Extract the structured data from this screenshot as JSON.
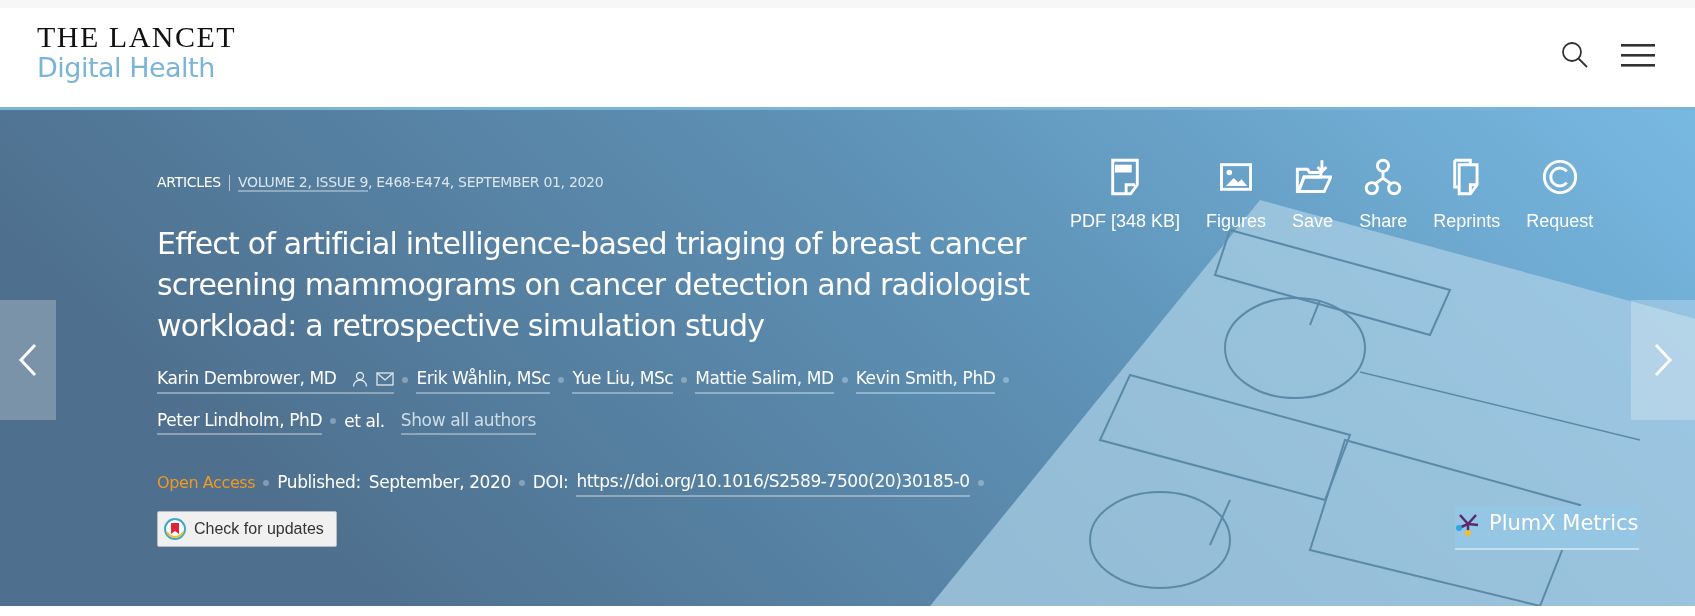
{
  "header": {
    "logo_top": "THE LANCET",
    "logo_bottom": "Digital Health"
  },
  "banner": {
    "article_type": "ARTICLES",
    "issue_link": "VOLUME 2, ISSUE 9",
    "issue_rest": ", E468-E474, SEPTEMBER 01, 2020",
    "actions": [
      {
        "kind": "pdf",
        "label": "PDF [348 KB]"
      },
      {
        "kind": "figures",
        "label": "Figures"
      },
      {
        "kind": "save",
        "label": "Save"
      },
      {
        "kind": "share",
        "label": "Share"
      },
      {
        "kind": "reprints",
        "label": "Reprints"
      },
      {
        "kind": "request",
        "label": "Request"
      }
    ],
    "title": "Effect of artificial intelligence-based triaging of breast cancer screening mammograms on cancer detection and radiologist workload: a retrospective simulation study",
    "authors": [
      {
        "name": "Karin Dembrower, MD",
        "kind": "corresponding"
      },
      {
        "name": "Erik Wåhlin, MSc",
        "kind": "author"
      },
      {
        "name": "Yue Liu, MSc",
        "kind": "author"
      },
      {
        "name": "Mattie Salim, MD",
        "kind": "author"
      },
      {
        "name": "Kevin Smith, PhD",
        "kind": "author"
      },
      {
        "name": "Peter Lindholm, PhD",
        "kind": "author"
      }
    ],
    "et_al": "et al.",
    "show_all": "Show all authors",
    "access": "Open Access",
    "published_label": "Published:",
    "published_value": "September, 2020",
    "doi_label": "DOI:",
    "doi": "https://doi.org/10.1016/S2589-7500(20)30185-0",
    "check_updates": "Check for updates",
    "plumx": "PlumX Metrics"
  }
}
